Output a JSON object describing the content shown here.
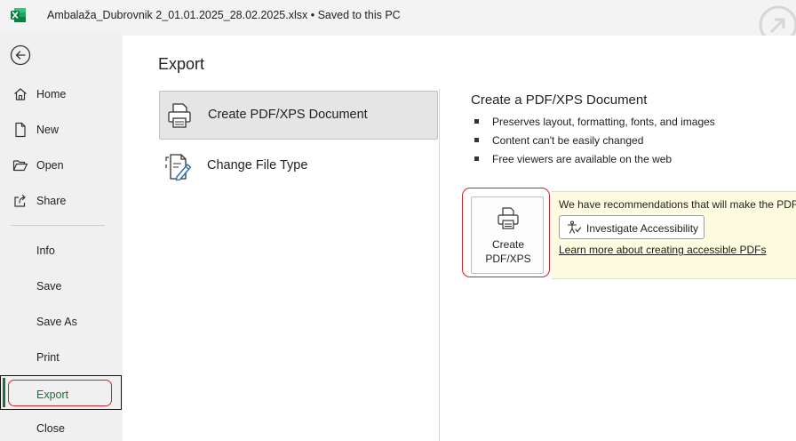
{
  "window": {
    "title": "Ambalaža_Dubrovnik 2_01.01.2025_28.02.2025.xlsx  •  Saved to this PC",
    "app_icon": "excel-logo-icon"
  },
  "sidebar": {
    "back_icon": "back-arrow-icon",
    "items": [
      {
        "label": "Home",
        "icon": "home-icon"
      },
      {
        "label": "New",
        "icon": "new-document-icon"
      },
      {
        "label": "Open",
        "icon": "folder-open-icon"
      },
      {
        "label": "Share",
        "icon": "share-icon"
      },
      {
        "label": "Info"
      },
      {
        "label": "Save"
      },
      {
        "label": "Save As"
      },
      {
        "label": "Print"
      },
      {
        "label": "Export",
        "selected": true
      },
      {
        "label": "Close"
      }
    ]
  },
  "main": {
    "title": "Export",
    "options": [
      {
        "label": "Create PDF/XPS Document",
        "icon": "pdf-printer-icon",
        "selected": true
      },
      {
        "label": "Change File Type",
        "icon": "change-file-type-icon"
      }
    ],
    "detail": {
      "title": "Create a PDF/XPS Document",
      "bullets": [
        "Preserves layout, formatting, fonts, and images",
        "Content can't be easily changed",
        "Free viewers are available on the web"
      ],
      "create_button": {
        "line1": "Create",
        "line2": "PDF/XPS"
      },
      "recommendation": {
        "text": "We have recommendations that will make the PDF",
        "button_label": "Investigate Accessibility",
        "link_text": "Learn more about creating accessible PDFs"
      }
    }
  },
  "colors": {
    "accent_green": "#1d7044",
    "highlight_red": "#d0232a",
    "recommend_bg": "#fefce0"
  }
}
